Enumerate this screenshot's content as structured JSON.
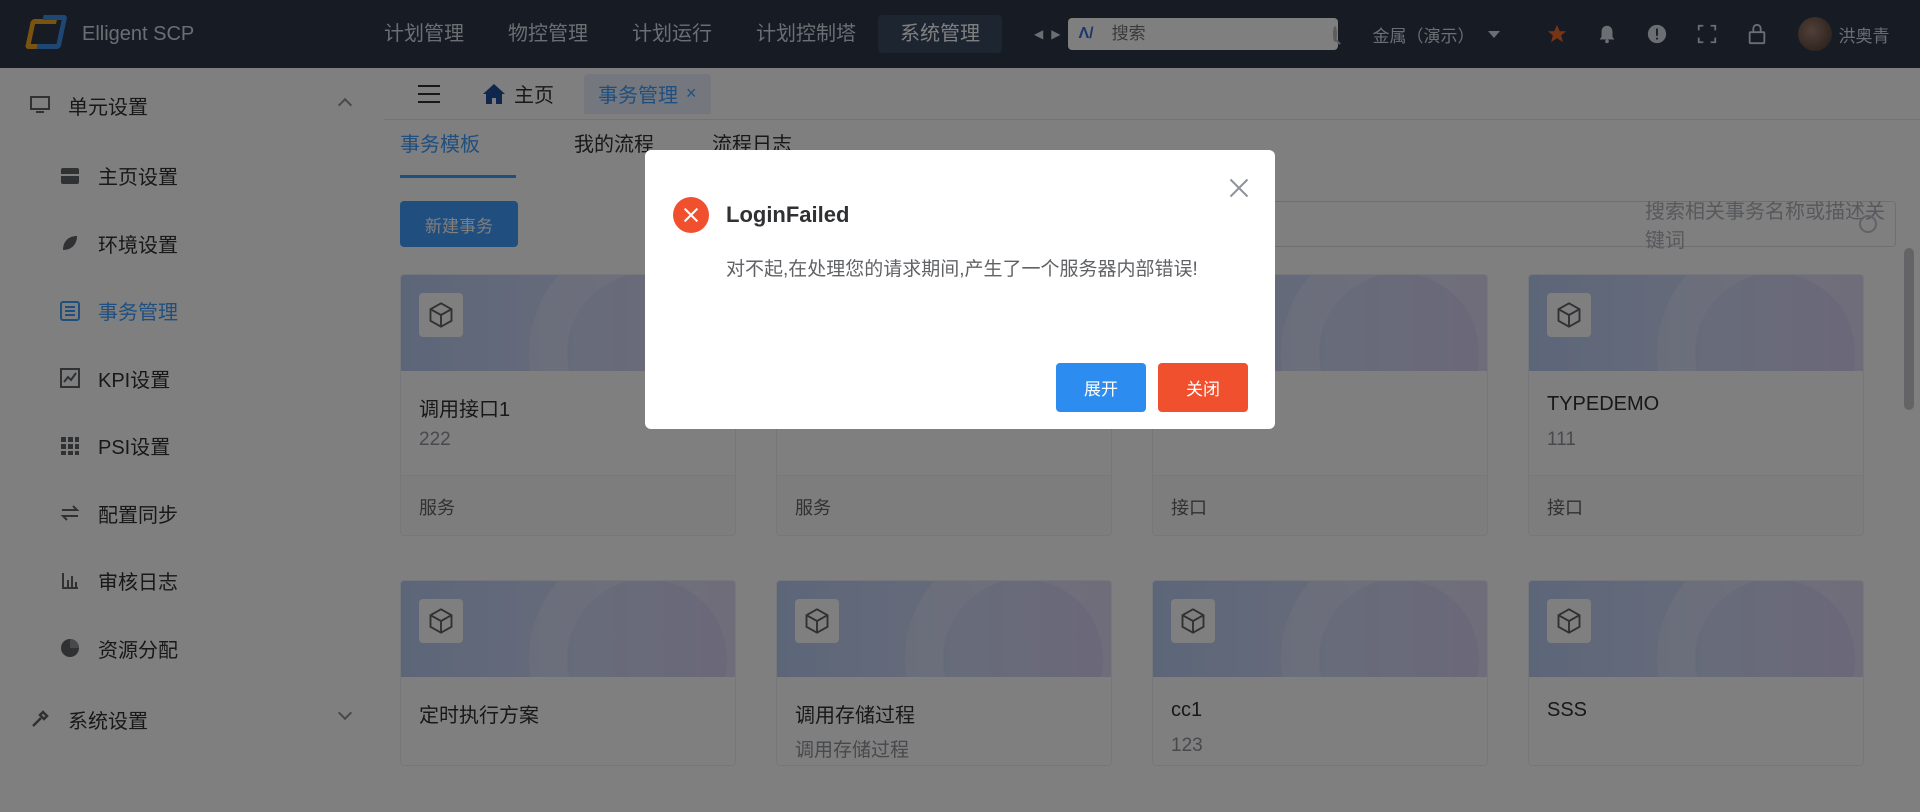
{
  "app": {
    "title": "Elligent SCP"
  },
  "topnav": {
    "items": [
      "计划管理",
      "物控管理",
      "计划运行",
      "计划控制塔",
      "系统管理"
    ],
    "active_index": 4,
    "search_placeholder": "搜索",
    "company": "金属（演示）",
    "user": "洪奥青"
  },
  "sidebar": {
    "group1": "单元设置",
    "items": [
      "主页设置",
      "环境设置",
      "事务管理",
      "KPI设置",
      "PSI设置",
      "配置同步",
      "审核日志",
      "资源分配"
    ],
    "active_index": 2,
    "group2": "系统设置"
  },
  "tabs": {
    "home": "主页",
    "current": "事务管理"
  },
  "subtabs": [
    "事务模板",
    "我的流程",
    "流程日志"
  ],
  "toolbar": {
    "new_button": "新建事务",
    "search_placeholder": "搜索相关事务名称或描述关键词"
  },
  "cards": [
    {
      "title": "调用接口1",
      "desc": "222",
      "type": "服务"
    },
    {
      "title": "",
      "desc": "",
      "type": "服务"
    },
    {
      "title": "",
      "desc": "",
      "type": "接口"
    },
    {
      "title": "TYPEDEMO",
      "desc": "111",
      "type": "接口"
    },
    {
      "title": "定时执行方案",
      "desc": "",
      "type": ""
    },
    {
      "title": "调用存储过程",
      "desc": "调用存储过程",
      "type": ""
    },
    {
      "title": "cc1",
      "desc": "123",
      "type": ""
    },
    {
      "title": "SSS",
      "desc": "",
      "type": ""
    }
  ],
  "dialog": {
    "title": "LoginFailed",
    "message": "对不起,在处理您的请求期间,产生了一个服务器内部错误!",
    "expand_label": "展开",
    "close_label": "关闭"
  },
  "colors": {
    "topbar": "#2c3748",
    "primary": "#409eff",
    "danger": "#f0502e",
    "accent_star": "#f06a2c"
  },
  "icons": [
    "menu-icon",
    "home-icon",
    "cube-icon",
    "star-icon",
    "bell-icon",
    "alert-icon",
    "fullscreen-icon",
    "lock-icon",
    "close-icon",
    "error-icon"
  ]
}
